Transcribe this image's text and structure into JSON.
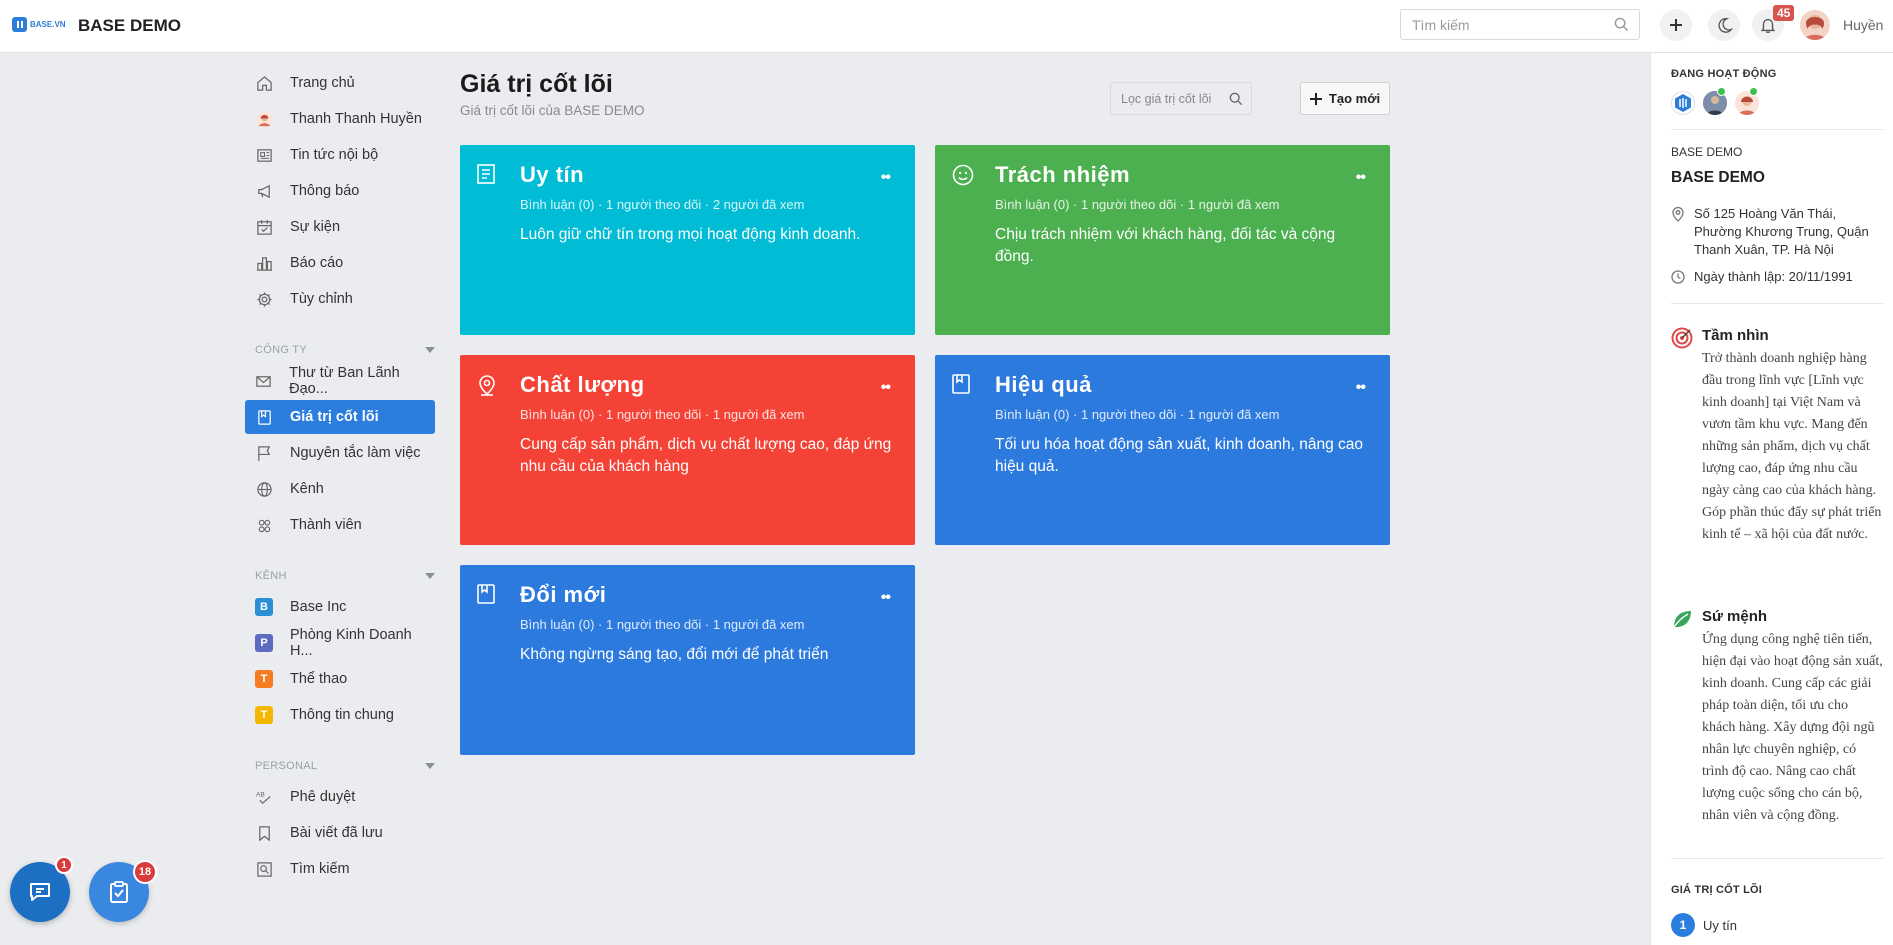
{
  "topbar": {
    "logo_text": "BASE.VN",
    "brand": "BASE DEMO",
    "search_placeholder": "Tìm kiếm",
    "notification_count": "45",
    "username": "Huyền"
  },
  "sidebar": {
    "main_items": [
      {
        "label": "Trang chủ",
        "icon": "home-icon"
      },
      {
        "label": "Thanh Thanh Huyền",
        "icon": "user-avatar"
      },
      {
        "label": "Tin tức nội bộ",
        "icon": "news-icon"
      },
      {
        "label": "Thông báo",
        "icon": "megaphone-icon"
      },
      {
        "label": "Sự kiện",
        "icon": "calendar-icon"
      },
      {
        "label": "Báo cáo",
        "icon": "chart-icon"
      },
      {
        "label": "Tùy chỉnh",
        "icon": "gear-icon"
      }
    ],
    "company_header": "CÔNG TY",
    "company_items": [
      {
        "label": "Thư từ Ban Lãnh Đạo...",
        "icon": "mail-icon"
      },
      {
        "label": "Giá trị cốt lõi",
        "icon": "book-icon",
        "active": true
      },
      {
        "label": "Nguyên tắc làm việc",
        "icon": "flag-icon"
      },
      {
        "label": "Kênh",
        "icon": "globe-icon"
      },
      {
        "label": "Thành viên",
        "icon": "members-icon"
      }
    ],
    "channel_header": "KÊNH",
    "channel_items": [
      {
        "label": "Base Inc",
        "letter": "B",
        "color": "#2b8fd6"
      },
      {
        "label": "Phòng Kinh Doanh H...",
        "letter": "P",
        "color": "#5c6bc0"
      },
      {
        "label": "Thể thao",
        "letter": "T",
        "color": "#f57c23"
      },
      {
        "label": "Thông tin chung",
        "letter": "T",
        "color": "#f5b800"
      }
    ],
    "personal_header": "PERSONAL",
    "personal_items": [
      {
        "label": "Phê duyệt",
        "icon": "approve-icon"
      },
      {
        "label": "Bài viết đã lưu",
        "icon": "bookmark-icon"
      },
      {
        "label": "Tìm kiếm",
        "icon": "search-icon"
      }
    ]
  },
  "main": {
    "title": "Giá trị cốt lõi",
    "subtitle": "Giá trị cốt lõi của BASE DEMO",
    "filter_placeholder": "Lọc giá trị cốt lõi",
    "create_label": "Tạo mới",
    "cards": [
      {
        "title": "Uy tín",
        "meta": "Bình luận (0) · 1 người theo dõi · 2 người đã xem",
        "desc": "Luôn giữ chữ tín trong mọi hoạt động kinh doanh.",
        "color": "#00bcd4",
        "icon": "document-icon"
      },
      {
        "title": "Trách nhiệm",
        "meta": "Bình luận (0) · 1 người theo dõi · 1 người đã xem",
        "desc": "Chịu trách nhiệm với khách hàng, đối tác và cộng đồng.",
        "color": "#4caf50",
        "icon": "smile-icon"
      },
      {
        "title": "Chất lượng",
        "meta": "Bình luận (0) · 1 người theo dõi · 1 người đã xem",
        "desc": "Cung cấp sản phẩm, dịch vụ chất lượng cao, đáp ứng nhu cầu của khách hàng",
        "color": "#f44336",
        "icon": "location-icon"
      },
      {
        "title": "Hiệu quả",
        "meta": "Bình luận (0) · 1 người theo dõi · 1 người đã xem",
        "desc": "Tối ưu hóa hoạt động sản xuất, kinh doanh, nâng cao hiệu quả.",
        "color": "#2c7ade",
        "icon": "book-icon"
      },
      {
        "title": "Đổi mới",
        "meta": "Bình luận (0) · 1 người theo dõi · 1 người đã xem",
        "desc": "Không ngừng sáng tạo, đổi mới để phát triển",
        "color": "#2c7ade",
        "icon": "book-icon"
      }
    ]
  },
  "right_panel": {
    "active_header": "ĐANG HOẠT ĐỘNG",
    "company_label": "BASE DEMO",
    "company_name": "BASE DEMO",
    "address": "Số 125 Hoàng Văn Thái, Phường Khương Trung, Quận Thanh Xuân, TP. Hà Nội",
    "founded": "Ngày thành lập: 20/11/1991",
    "vision_title": "Tầm nhìn",
    "vision_text": "Trở thành doanh nghiệp hàng đầu trong lĩnh vực [Lĩnh vực kinh doanh] tại Việt Nam và vươn tầm khu vực. Mang đến những sản phẩm, dịch vụ chất lượng cao, đáp ứng nhu cầu ngày càng cao của khách hàng. Góp phần thúc đẩy sự phát triển kinh tế – xã hội của đất nước.",
    "mission_title": "Sứ mệnh",
    "mission_text": "Ứng dụng công nghệ tiên tiến, hiện đại vào hoạt động sản xuất, kinh doanh. Cung cấp các giải pháp toàn diện, tối ưu cho khách hàng. Xây dựng đội ngũ nhân lực chuyên nghiệp, có trình độ cao. Nâng cao chất lượng cuộc sống cho cán bộ, nhân viên và cộng đồng.",
    "core_values_header": "GIÁ TRỊ CỐT LÕI",
    "core_value_first_num": "1",
    "core_value_first": "Uy tín"
  },
  "fabs": {
    "chat_badge": "1",
    "tasks_badge": "18"
  }
}
